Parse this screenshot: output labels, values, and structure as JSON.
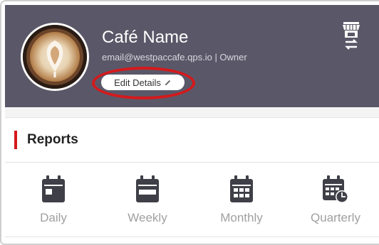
{
  "profile": {
    "name": "Café Name",
    "meta": "email@westpaccafe.qps.io | Owner",
    "edit_label": "Edit Details"
  },
  "reports": {
    "title": "Reports",
    "items": [
      {
        "label": "Daily",
        "icon": "calendar-day-icon"
      },
      {
        "label": "Weekly",
        "icon": "calendar-week-icon"
      },
      {
        "label": "Monthly",
        "icon": "calendar-month-icon"
      },
      {
        "label": "Quarterly",
        "icon": "calendar-quarter-icon"
      }
    ]
  },
  "colors": {
    "header_bg": "#5a5868",
    "accent_red": "#d5191c",
    "icon_dark": "#3f3f47",
    "label_gray": "#a0a0a0"
  }
}
